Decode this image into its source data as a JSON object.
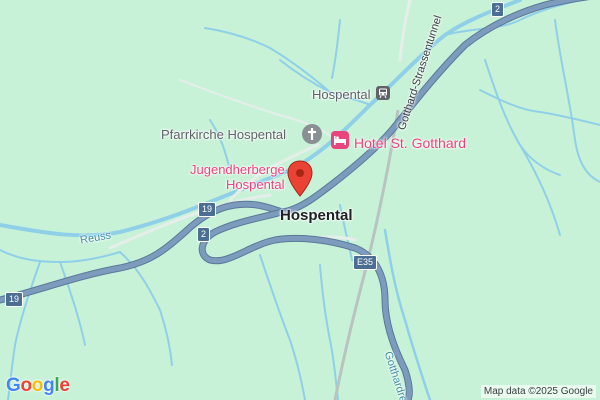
{
  "map": {
    "places": {
      "hospental_station": "Hospental",
      "church": "Pfarrkirche Hospental",
      "hotel": "Hotel St. Gotthard",
      "hostel_line1": "Jugendherberge",
      "hostel_line2": "Hospental",
      "town": "Hospental"
    },
    "waterways": {
      "reuss": "Reuss",
      "gotthardreuss": "Gotthardreuss"
    },
    "roads": {
      "tunnel": "Gotthard-Strassentunnel"
    },
    "shields": {
      "s2_top": "2",
      "s19_mid": "19",
      "s2_mid": "2",
      "e35": "E35",
      "s19_left": "19"
    },
    "attribution": "Map data ©2025 Google",
    "logo": {
      "letters": [
        "G",
        "o",
        "o",
        "g",
        "l",
        "e"
      ]
    },
    "colors": {
      "background": "#c8f2d8",
      "river": "#8fd0e8",
      "highway": "#7d9cbd",
      "highway_outline": "#5a7898",
      "hotel_pink": "#e8457e",
      "marker_red": "#ea4335",
      "shield": "#4b6e92"
    }
  }
}
